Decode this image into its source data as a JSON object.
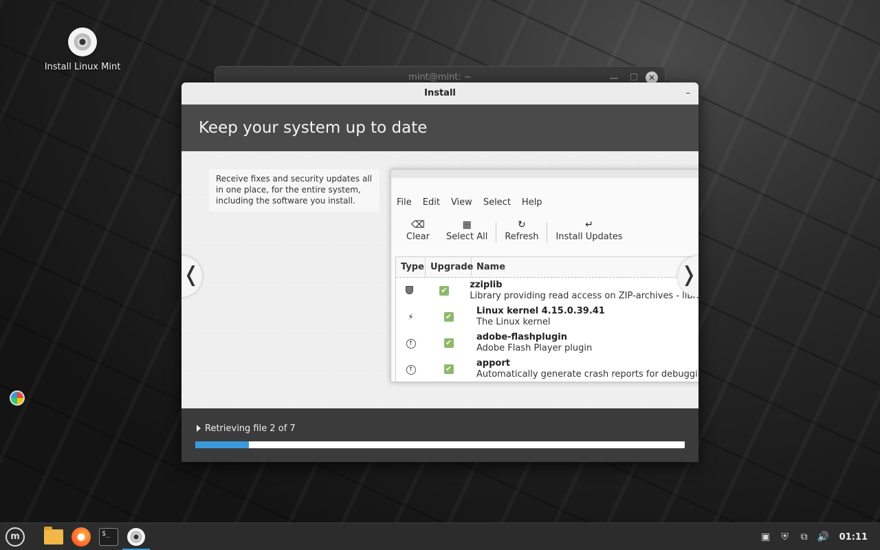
{
  "desktop": {
    "icon_label": "Install Linux Mint"
  },
  "terminal": {
    "title": "mint@mint: ~",
    "close_glyph": "✕"
  },
  "installer": {
    "window_title": "Install",
    "minimize_glyph": "–",
    "heading": "Keep your system up to date",
    "description": "Receive fixes and security updates all in one place, for the entire system, including the software you install.",
    "prev_glyph": "❬",
    "next_glyph": "❭",
    "status_text": "Retrieving file 2 of 7",
    "progress_fraction": 0.11,
    "accent_color": "#3a9ad9"
  },
  "update_manager": {
    "menu": [
      "File",
      "Edit",
      "View",
      "Select",
      "Help"
    ],
    "toolbar": [
      {
        "label": "Clear",
        "icon": "clear-icon",
        "glyph": "⌫"
      },
      {
        "label": "Select All",
        "icon": "select-all-icon",
        "glyph": "▦"
      },
      {
        "label": "Refresh",
        "icon": "refresh-icon",
        "glyph": "↻"
      },
      {
        "label": "Install Updates",
        "icon": "install-updates-icon",
        "glyph": "↵"
      }
    ],
    "columns": [
      "Type",
      "Upgrade",
      "Name"
    ],
    "rows": [
      {
        "type_icon": "security-shield-icon",
        "name": "zziplib",
        "desc": "Library providing read access on ZIP-archives - library",
        "checked": true
      },
      {
        "type_icon": "kernel-bolt-icon",
        "name": "Linux kernel 4.15.0.39.41",
        "desc": "The Linux kernel",
        "checked": true
      },
      {
        "type_icon": "upgrade-arrow-icon",
        "name": "adobe-flashplugin",
        "desc": "Adobe Flash Player plugin",
        "checked": true
      },
      {
        "type_icon": "upgrade-arrow-icon",
        "name": "apport",
        "desc": "Automatically generate crash reports for debugging",
        "checked": true
      }
    ]
  },
  "taskbar": {
    "menu_glyph": "m",
    "terminal_glyph": "$_",
    "clock": "01:11"
  }
}
